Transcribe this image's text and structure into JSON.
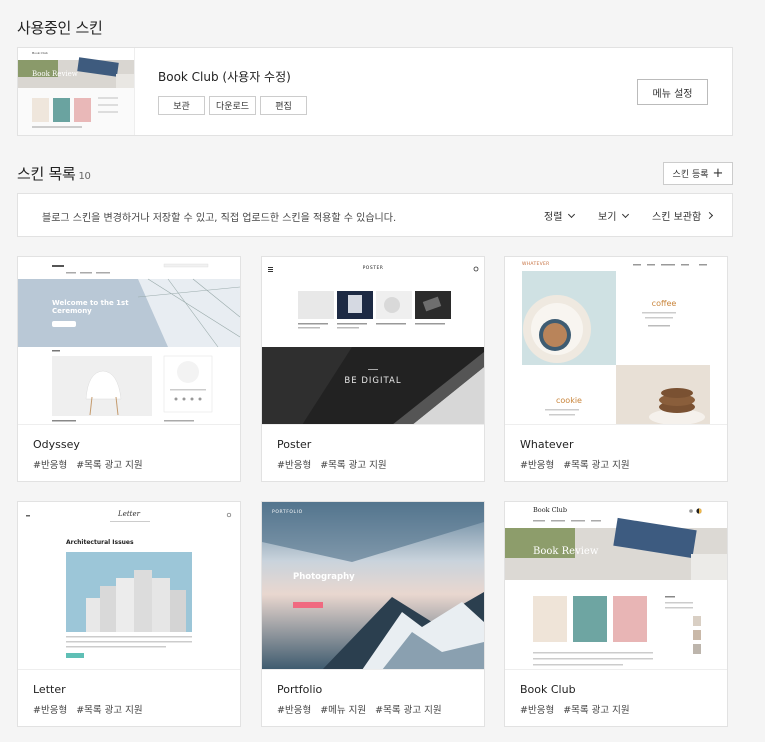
{
  "current_section": {
    "heading": "사용중인 스킨",
    "skin_name": "Book Club (사용자 수정)",
    "buttons": {
      "save": "보관",
      "download": "다운로드",
      "edit": "편집"
    },
    "menu_settings": "메뉴 설정",
    "thumb_text": "Book Review"
  },
  "list_section": {
    "heading": "스킨 목록",
    "count": "10",
    "register_label": "스킨 등록",
    "register_icon": "+",
    "description": "블로그 스킨을 변경하거나 저장할 수 있고, 직접 업로드한 스킨을 적용할 수 있습니다.",
    "sort_label": "정렬",
    "view_label": "보기",
    "storage_label": "스킨 보관함"
  },
  "skins": [
    {
      "name": "Odyssey",
      "tags": [
        "#반응형",
        "#목록 광고 지원"
      ],
      "thumb_text": "Welcome to the 1st Ceremony"
    },
    {
      "name": "Poster",
      "tags": [
        "#반응형",
        "#목록 광고 지원"
      ],
      "thumb_text": "BE DIGITAL",
      "thumb_brand": "POSTER"
    },
    {
      "name": "Whatever",
      "tags": [
        "#반응형",
        "#목록 광고 지원"
      ],
      "thumb_text_1": "coffee",
      "thumb_text_2": "cookie",
      "thumb_brand": "WHATEVER"
    },
    {
      "name": "Letter",
      "tags": [
        "#반응형",
        "#목록 광고 지원"
      ],
      "thumb_text": "Architectural Issues",
      "thumb_brand": "Letter"
    },
    {
      "name": "Portfolio",
      "tags": [
        "#반응형",
        "#메뉴 지원",
        "#목록 광고 지원"
      ],
      "thumb_text": "Photography",
      "thumb_brand": "PORTFOLIO"
    },
    {
      "name": "Book Club",
      "tags": [
        "#반응형",
        "#목록 광고 지원"
      ],
      "thumb_text": "Book Review",
      "thumb_brand": "Book Club"
    }
  ],
  "colors": {
    "page_bg": "#f5f5f5",
    "card_bg": "#ffffff",
    "border": "#e2e2e2",
    "portfolio_btn": "#f06a80"
  }
}
